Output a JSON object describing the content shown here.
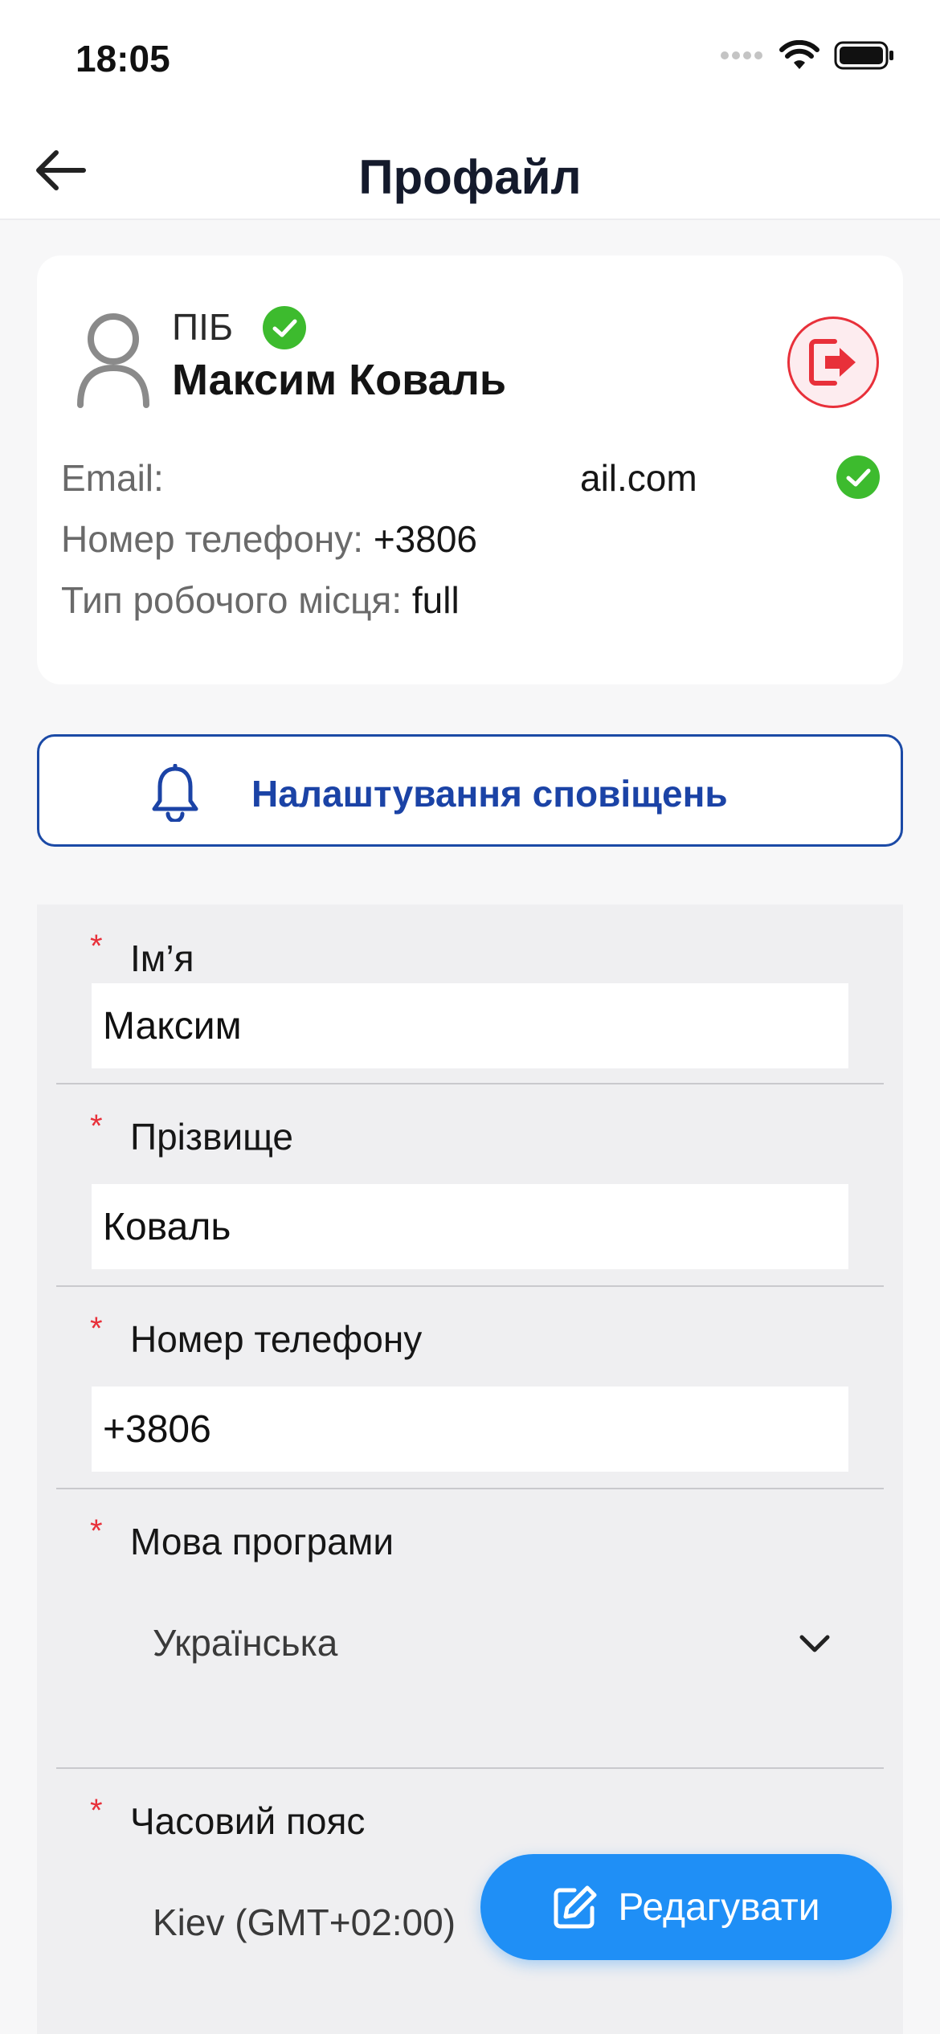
{
  "status_bar": {
    "time": "18:05"
  },
  "nav": {
    "title": "Профайл"
  },
  "profile": {
    "pib_label": "ПІБ",
    "full_name": "Максим Коваль",
    "email_label": "Email:",
    "email_value_partial": "ail.com",
    "phone_label": "Номер телефону:",
    "phone_value": "+3806",
    "worktype_label": "Тип робочого місця:",
    "worktype_value": "full"
  },
  "notifications_button": {
    "label": "Налаштування сповіщень"
  },
  "form": {
    "required_mark": "*",
    "first_name": {
      "label": "Ім’я",
      "value": "Максим"
    },
    "last_name": {
      "label": "Прізвище",
      "value": "Коваль"
    },
    "phone": {
      "label": "Номер телефону",
      "value": "+3806"
    },
    "language": {
      "label": "Мова програми",
      "value": "Українська"
    },
    "timezone": {
      "label": "Часовий пояс",
      "value": "Kiev (GMT+02:00)"
    }
  },
  "edit_button": {
    "label": "Редагувати"
  },
  "colors": {
    "accent_blue": "#1f8ff6",
    "nav_blue": "#1b43a6",
    "danger_red": "#e8303a",
    "verified_green": "#3dbb2e"
  }
}
